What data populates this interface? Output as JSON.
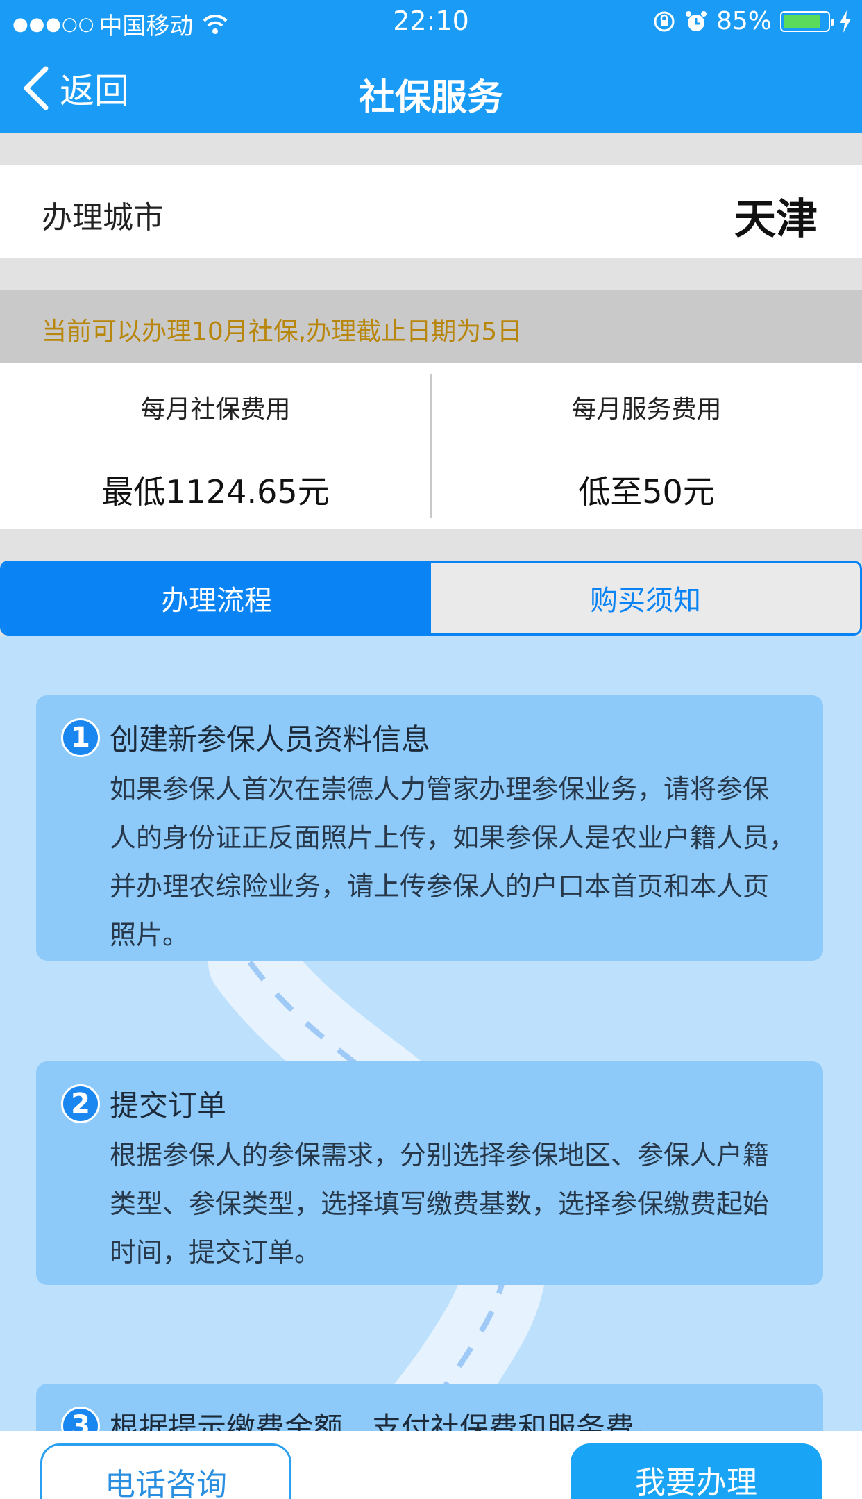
{
  "status_bar": {
    "signal": "●●●○○",
    "carrier": "中国移动",
    "time": "22:10",
    "battery": "85%",
    "battery_level": 0.85
  },
  "nav": {
    "back_label": "返回",
    "title": "社保服务"
  },
  "city": {
    "label": "办理城市",
    "value": "天津"
  },
  "notice": "当前可以办理10月社保,办理截止日期为5日",
  "fees": {
    "social_label": "每月社保费用",
    "social_value": "最低1124.65元",
    "service_label": "每月服务费用",
    "service_value": "低至50元"
  },
  "tabs": [
    {
      "label": "办理流程",
      "active": true
    },
    {
      "label": "购买须知",
      "active": false
    }
  ],
  "steps": [
    {
      "num": "1",
      "title": "创建新参保人员资料信息",
      "lines": [
        "如果参保人首次在崇德人力管家办理参保业务，请将参保",
        "人的身份证正反面照片上传，如果参保人是农业户籍人员，",
        "并办理农综险业务，请上传参保人的户口本首页和本人页",
        "照片。"
      ]
    },
    {
      "num": "2",
      "title": "提交订单",
      "lines": [
        "根据参保人的参保需求，分别选择参保地区、参保人户籍",
        "类型、参保类型，选择填写缴费基数，选择参保缴费起始",
        "时间，提交订单。"
      ]
    },
    {
      "num": "3",
      "title": "根据提示缴费金额，支付社保费和服务费。",
      "lines": []
    }
  ],
  "bottom": {
    "consult_label": "电话咨询",
    "apply_label": "我要办理"
  },
  "colors": {
    "primary": "#1a9cf6",
    "tab_active": "#0a84f5",
    "notice_text": "#b8860b",
    "process_bg": "#bde0fc",
    "step_card": "#8dcafa"
  }
}
